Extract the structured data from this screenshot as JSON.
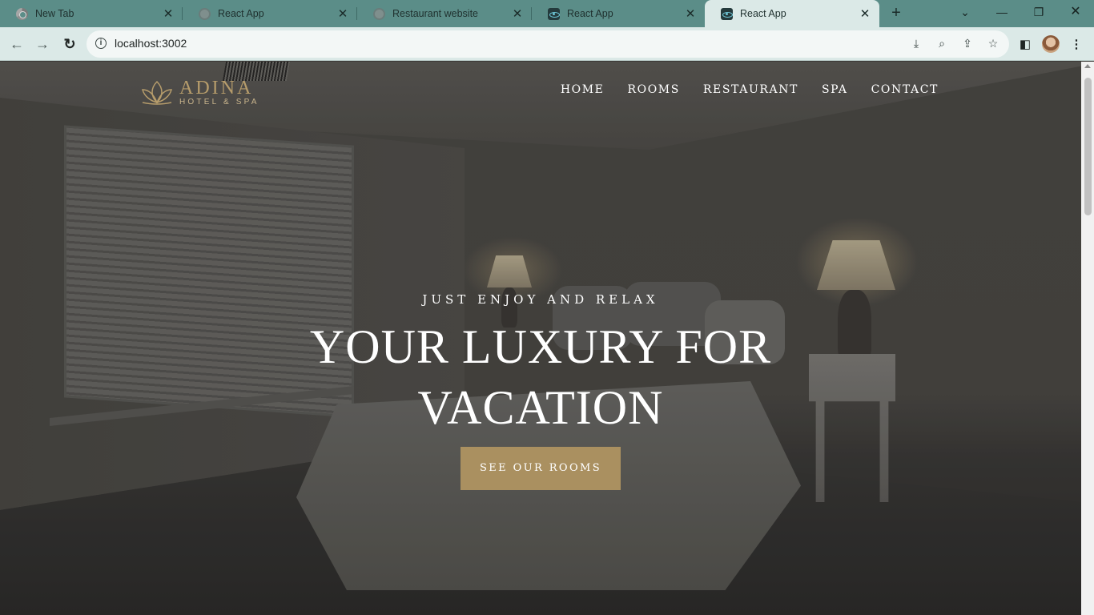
{
  "browser": {
    "tabs": [
      {
        "title": "New Tab",
        "icon": "chrome-icon",
        "active": false
      },
      {
        "title": "React App",
        "icon": "globe-icon",
        "active": false
      },
      {
        "title": "Restaurant website",
        "icon": "globe-icon",
        "active": false
      },
      {
        "title": "React App",
        "icon": "react-icon",
        "active": false
      },
      {
        "title": "React App",
        "icon": "react-icon",
        "active": true
      }
    ],
    "url": "localhost:3002",
    "colors": {
      "tabbar": "#5b8d88",
      "toolbar": "#dbe9e7"
    }
  },
  "site": {
    "logo": {
      "name": "ADINA",
      "sub": "HOTEL & SPA",
      "color": "#b69c6b"
    },
    "nav": [
      "HOME",
      "ROOMS",
      "RESTAURANT",
      "SPA",
      "CONTACT"
    ],
    "hero": {
      "subtitle": "JUST ENJOY AND RELAX",
      "title_line1": "YOUR LUXURY FOR",
      "title_line2": "VACATION",
      "button": "SEE OUR ROOMS",
      "button_color": "#aa9060"
    }
  }
}
